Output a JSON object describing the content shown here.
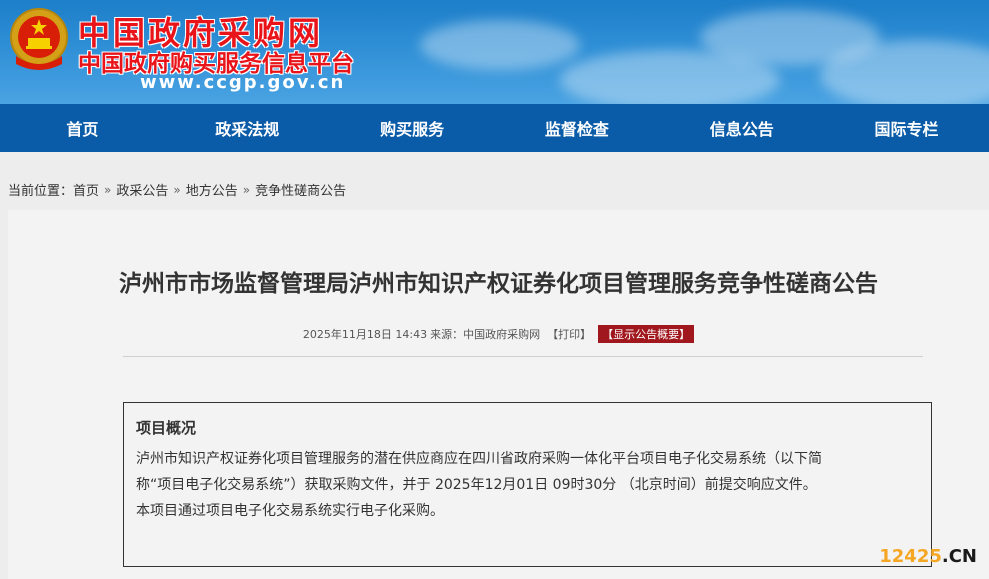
{
  "header": {
    "title": "中国政府采购网",
    "subtitle": "中国政府购买服务信息平台",
    "url": "www.ccgp.gov.cn",
    "emblem": "national-emblem"
  },
  "nav": {
    "items": [
      "首页",
      "政采法规",
      "购买服务",
      "监督检查",
      "信息公告",
      "国际专栏"
    ]
  },
  "breadcrumb": {
    "prefix": "当前位置：",
    "items": [
      "首页",
      "政采公告",
      "地方公告",
      "竞争性磋商公告"
    ],
    "separator": "»"
  },
  "article": {
    "title": "泸州市市场监督管理局泸州市知识产权证券化项目管理服务竞争性磋商公告",
    "meta_date": "2025年11月18日 14:43",
    "meta_source": "来源：中国政府采购网",
    "meta_print": "【打印】",
    "meta_summary": "【显示公告概要】"
  },
  "overview": {
    "heading": "项目概况",
    "lines": [
      "泸州市知识产权证券化项目管理服务的潜在供应商应在四川省政府采购一体化平台项目电子化交易系统（以下简",
      "称“项目电子化交易系统”）获取采购文件，并于 2025年12月01日 09时30分 （北京时间）前提交响应文件。",
      "本项目通过项目电子化交易系统实行电子化采购。"
    ]
  },
  "watermark": {
    "num": "12425",
    "suffix": ".CN"
  },
  "colors": {
    "nav_bg": "#0b5ca8",
    "title_red": "#e8141a",
    "summary_btn": "#a0171d"
  }
}
